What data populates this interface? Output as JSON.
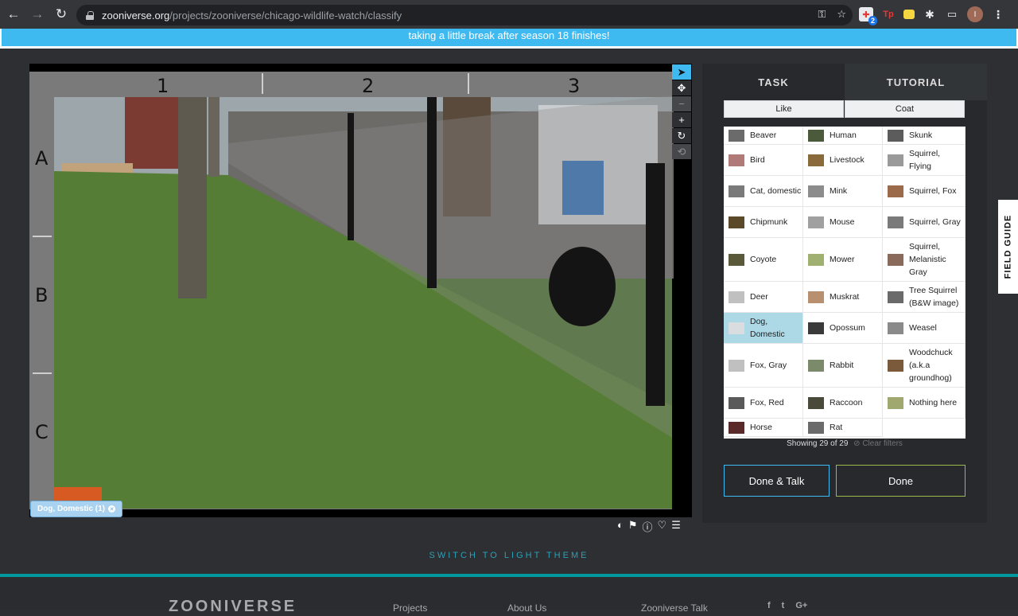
{
  "browser": {
    "url_domain": "zooniverse.org",
    "url_path": "/projects/zooniverse/chicago-wildlife-watch/classify",
    "ext_badge_count": "2",
    "ext_tp_label": "Tp",
    "profile_initial": "I"
  },
  "banner": {
    "text": "taking a little break after season 18 finishes!"
  },
  "viewer": {
    "column_labels": [
      "1",
      "2",
      "3"
    ],
    "row_labels": [
      "A",
      "B",
      "C"
    ],
    "mark_chip": "Dog, Domestic (1)"
  },
  "task": {
    "tabs": [
      "TASK",
      "TUTORIAL"
    ],
    "filters": [
      "Like",
      "Coat"
    ],
    "choices": [
      "Beaver",
      "Human",
      "Skunk",
      "Bird",
      "Livestock",
      "Squirrel, Flying",
      "Cat, domestic",
      "Mink",
      "Squirrel, Fox",
      "Chipmunk",
      "Mouse",
      "Squirrel, Gray",
      "Coyote",
      "Mower",
      "Squirrel, Melanistic Gray",
      "Deer",
      "Muskrat",
      "Tree Squirrel (B&W image)",
      "Dog, Domestic",
      "Opossum",
      "Weasel",
      "Fox, Gray",
      "Rabbit",
      "Woodchuck (a.k.a groundhog)",
      "Fox, Red",
      "Raccoon",
      "Nothing here",
      "Horse",
      "Rat"
    ],
    "selected_choice": "Dog, Domestic",
    "showing": "Showing 29 of 29",
    "clear_filters": "Clear filters",
    "done_talk": "Done & Talk",
    "done": "Done"
  },
  "field_guide": "FIELD GUIDE",
  "theme_switch": "SWITCH TO LIGHT THEME",
  "footer": {
    "logo": "ZOONIVERSE",
    "links": [
      "Projects",
      "About Us",
      "Zooniverse Talk"
    ],
    "social": [
      "f",
      "t",
      "G+"
    ]
  }
}
